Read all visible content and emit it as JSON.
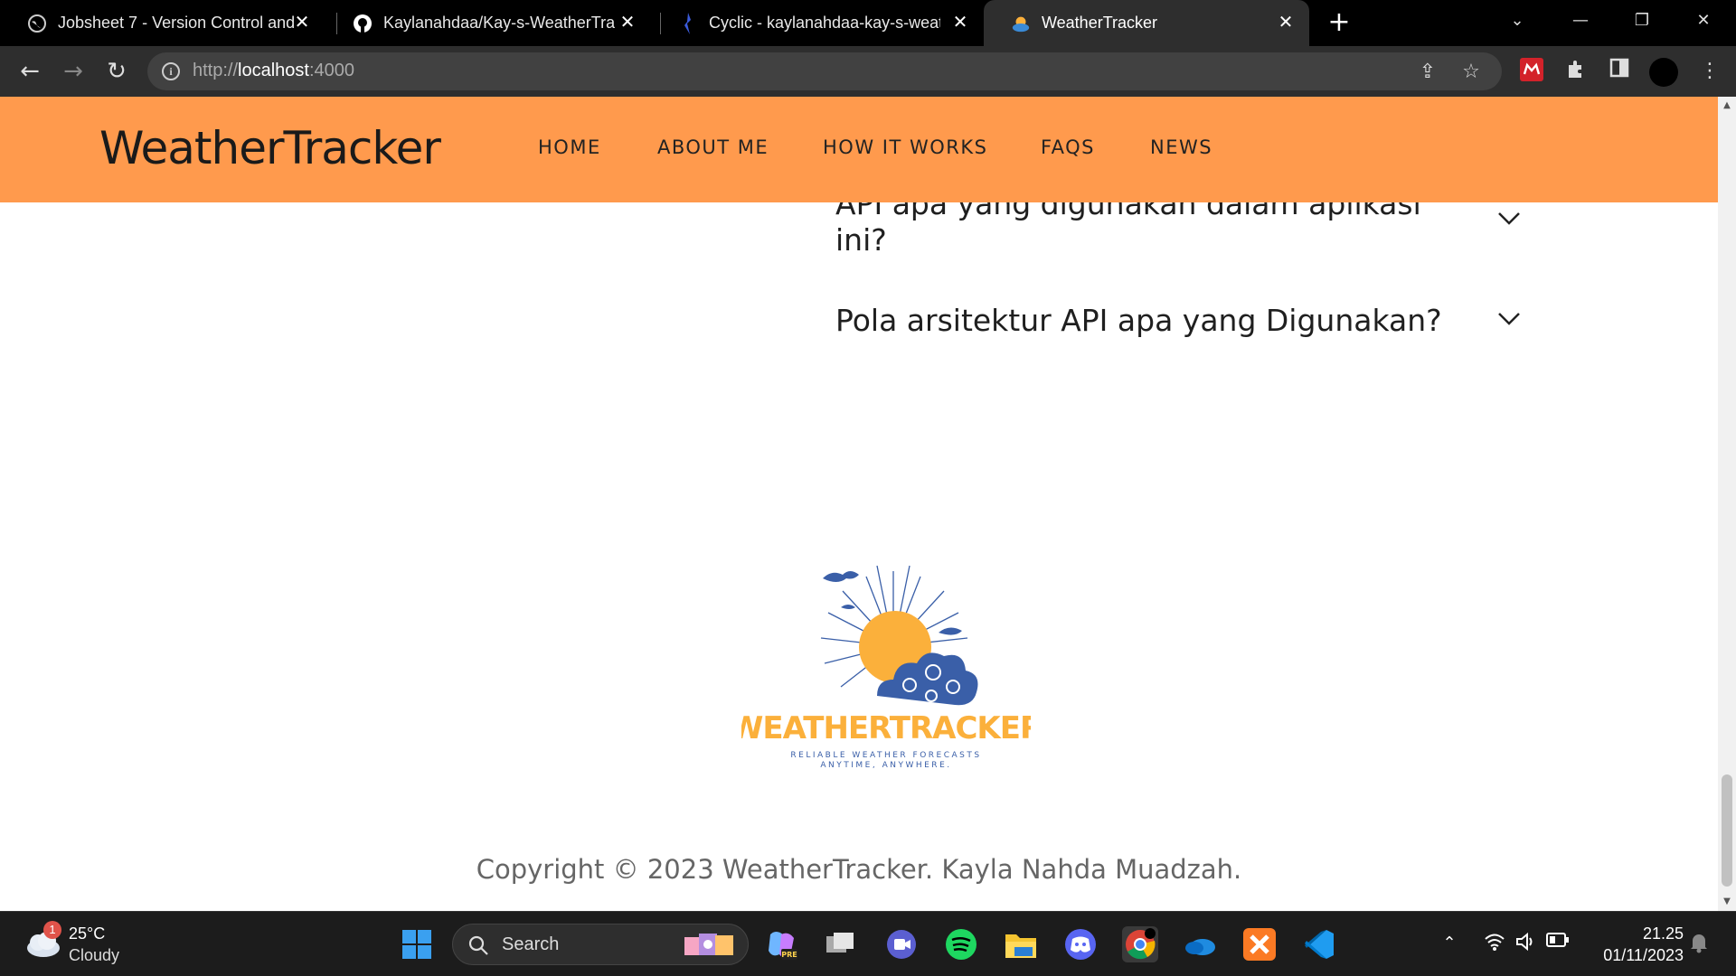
{
  "browser": {
    "tabs": [
      {
        "title": "Jobsheet 7 - Version Control and",
        "active": false
      },
      {
        "title": "Kaylanahdaa/Kay-s-WeatherTrac",
        "active": false
      },
      {
        "title": "Cyclic - kaylanahdaa-kay-s-weat",
        "active": false
      },
      {
        "title": "WeatherTracker",
        "active": true
      }
    ],
    "url_scheme": "http://",
    "url_host": "localhost",
    "url_port": ":4000"
  },
  "site": {
    "brand": "WeatherTracker",
    "nav": [
      "HOME",
      "ABOUT ME",
      "HOW IT WORKS",
      "FAQS",
      "NEWS"
    ],
    "faqs": [
      {
        "question": "API apa yang digunakan dalam aplikasi ini?"
      },
      {
        "question": "Pola arsitektur API apa yang Digunakan?"
      }
    ],
    "logo": {
      "wordmark": "WEATHERTRACKER",
      "tagline_1": "RELIABLE WEATHER FORECASTS",
      "tagline_2": "ANYTIME, ANYWHERE."
    },
    "copyright": "Copyright © 2023 WeatherTracker. Kayla Nahda Muadzah.",
    "colors": {
      "header": "#ff9a4d",
      "logo_sun": "#fbb03b",
      "logo_cloud": "#3a5fa8"
    }
  },
  "taskbar": {
    "weather_temp": "25°C",
    "weather_cond": "Cloudy",
    "weather_badge": "1",
    "search_label": "Search",
    "time": "21.25",
    "date": "01/11/2023"
  }
}
